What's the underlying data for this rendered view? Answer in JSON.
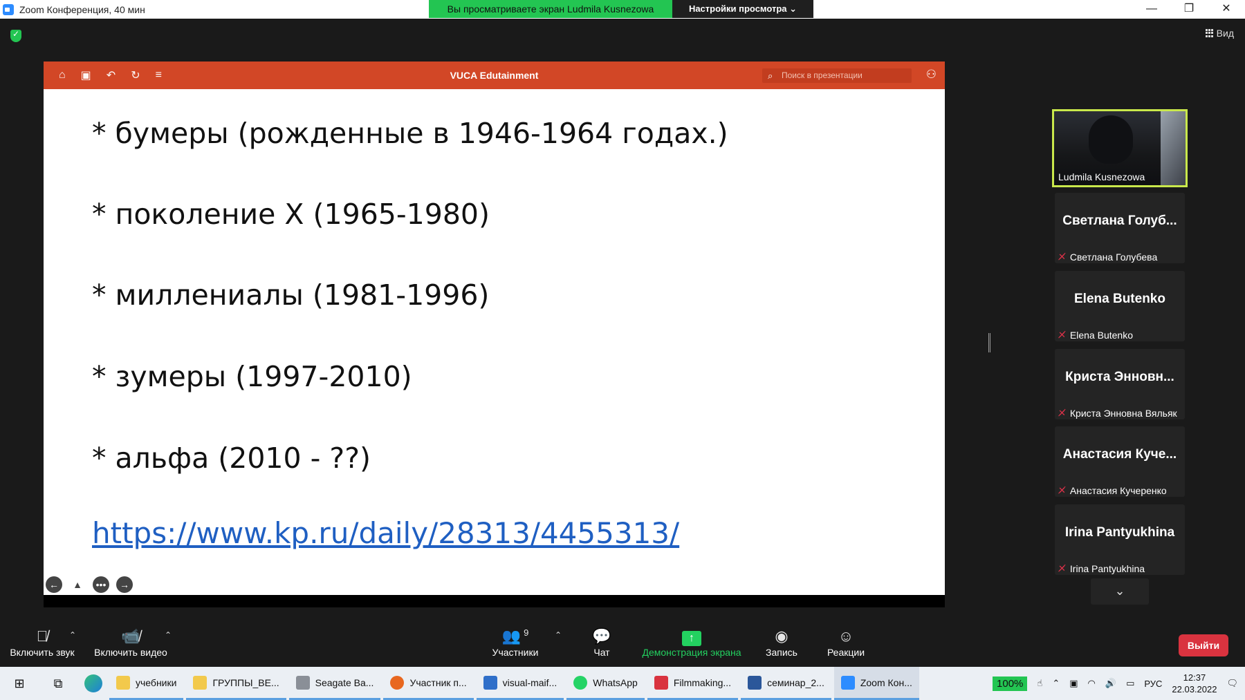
{
  "window": {
    "title": "Zoom Конференция, 40 мин",
    "banner_viewing": "Вы просматриваете экран Ludmila Kusnezowa",
    "banner_settings": "Настройки просмотра ⌄",
    "minimize": "—",
    "restore": "❐",
    "close": "✕"
  },
  "view_button": "Вид",
  "presentation": {
    "title": "VUCA Edutainment",
    "search_placeholder": "Поиск в презентации",
    "slide_lines": [
      "* бумеры (рожденные в 1946-1964 годах.)",
      "* поколение X (1965-1980)",
      "* миллениалы (1981-1996)",
      "* зумеры (1997-2010)",
      "* альфа (2010 - ??)"
    ],
    "link": "https://www.kp.ru/daily/28313/4455313/"
  },
  "participants": {
    "video": {
      "name": "Ludmila Kusnezowa"
    },
    "tiles": [
      {
        "big": "Светлана Голуб...",
        "small": "Светлана Голубева"
      },
      {
        "big": "Elena Butenko",
        "small": "Elena Butenko"
      },
      {
        "big": "Криста Энновн...",
        "small": "Криста Энновна Вяльяк"
      },
      {
        "big": "Анастасия Куче...",
        "small": "Анастасия Кучеренко"
      },
      {
        "big": "Irina Pantyukhina",
        "small": "Irina Pantyukhina"
      }
    ]
  },
  "toolbar": {
    "mute": "Включить звук",
    "video": "Включить видео",
    "participants": "Участники",
    "participants_count": "9",
    "chat": "Чат",
    "share": "Демонстрация экрана",
    "record": "Запись",
    "reactions": "Реакции",
    "exit": "Выйти"
  },
  "taskbar": {
    "apps": [
      {
        "label": "учебники",
        "color": "#f2c94c"
      },
      {
        "label": "ГРУППЫ_ВЕ...",
        "color": "#f2c94c"
      },
      {
        "label": "Seagate Ba...",
        "color": "#8a8f97"
      },
      {
        "label": "Участник п...",
        "color": "#e8671f"
      },
      {
        "label": "visual-maif...",
        "color": "#2f6fc9"
      },
      {
        "label": "WhatsApp",
        "color": "#25d366"
      },
      {
        "label": "Filmmaking...",
        "color": "#d9333f"
      },
      {
        "label": "семинар_2...",
        "color": "#2b579a"
      },
      {
        "label": "Zoom Кон...",
        "color": "#2d8cff"
      }
    ],
    "battery": "100%",
    "language": "РУС",
    "time": "12:37",
    "date": "22.03.2022"
  }
}
